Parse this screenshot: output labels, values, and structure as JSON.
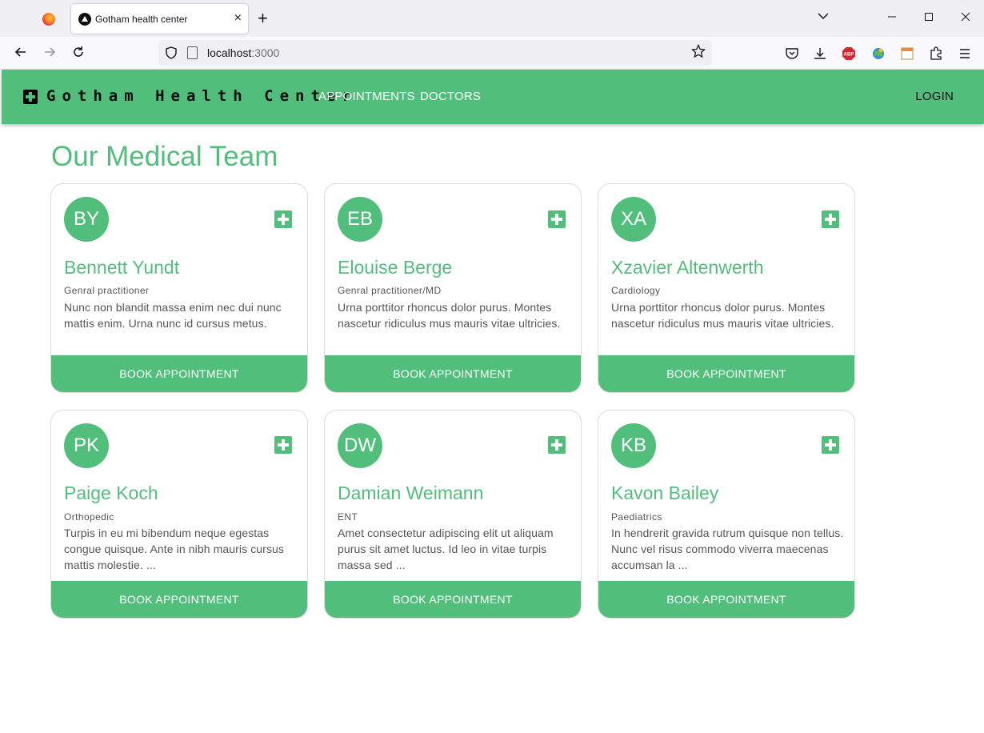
{
  "browser": {
    "tab_title": "Gotham health center",
    "tab_close": "×",
    "new_tab": "+",
    "url_host": "localhost",
    "url_port": ":3000"
  },
  "header": {
    "brand": "Gotham Health Center",
    "nav": [
      "APPOINTMENTS",
      "DOCTORS"
    ],
    "login": "LOGIN"
  },
  "page": {
    "title": "Our Medical Team"
  },
  "accent_color": "#52be7c",
  "doctors": [
    {
      "initials": "BY",
      "name": "Bennett Yundt",
      "specialty": "Genral practitioner",
      "description": "Nunc non blandit massa enim nec dui nunc mattis enim. Urna nunc id cursus metus.",
      "button": "BOOK APPOINTMENT"
    },
    {
      "initials": "EB",
      "name": "Elouise Berge",
      "specialty": "Genral practitioner/MD",
      "description": "Urna porttitor rhoncus dolor purus. Montes nascetur ridiculus mus mauris vitae ultricies.",
      "button": "BOOK APPOINTMENT"
    },
    {
      "initials": "XA",
      "name": "Xzavier Altenwerth",
      "specialty": "Cardiology",
      "description": "Urna porttitor rhoncus dolor purus. Montes nascetur ridiculus mus mauris vitae ultricies.",
      "button": "BOOK APPOINTMENT"
    },
    {
      "initials": "PK",
      "name": "Paige Koch",
      "specialty": "Orthopedic",
      "description": "Turpis in eu mi bibendum neque egestas congue quisque. Ante in nibh mauris cursus mattis molestie. ...",
      "button": "BOOK APPOINTMENT"
    },
    {
      "initials": "DW",
      "name": "Damian Weimann",
      "specialty": "ENT",
      "description": "Amet consectetur adipiscing elit ut aliquam purus sit amet luctus. Id leo in vitae turpis massa sed ...",
      "button": "BOOK APPOINTMENT"
    },
    {
      "initials": "KB",
      "name": "Kavon Bailey",
      "specialty": "Paediatrics",
      "description": "In hendrerit gravida rutrum quisque non tellus. Nunc vel risus commodo viverra maecenas accumsan la ...",
      "button": "BOOK APPOINTMENT"
    }
  ]
}
